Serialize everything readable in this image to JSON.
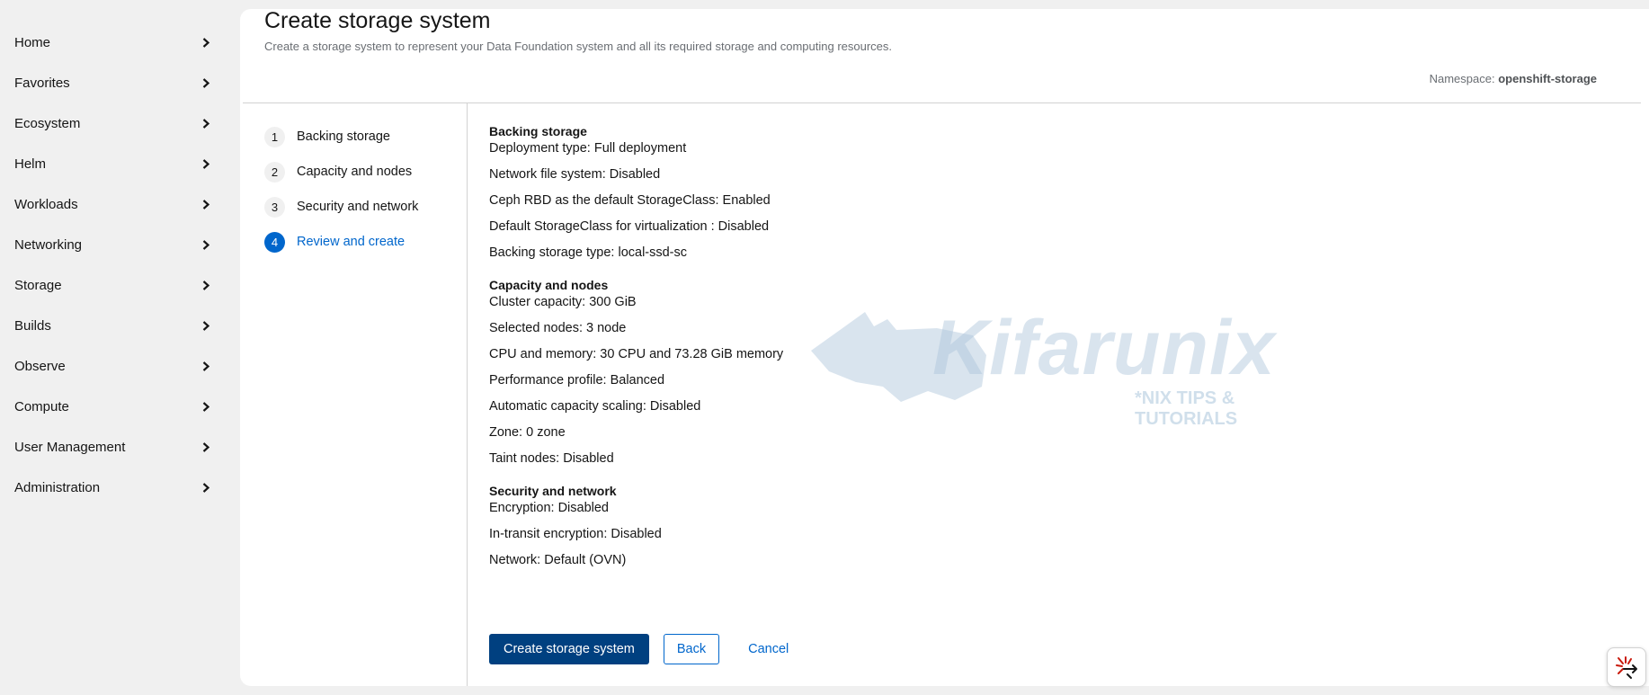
{
  "sidebar": {
    "items": [
      {
        "label": "Home"
      },
      {
        "label": "Favorites"
      },
      {
        "label": "Ecosystem"
      },
      {
        "label": "Helm"
      },
      {
        "label": "Workloads"
      },
      {
        "label": "Networking"
      },
      {
        "label": "Storage"
      },
      {
        "label": "Builds"
      },
      {
        "label": "Observe"
      },
      {
        "label": "Compute"
      },
      {
        "label": "User Management"
      },
      {
        "label": "Administration"
      }
    ]
  },
  "page": {
    "title": "Create storage system",
    "description": "Create a storage system to represent your Data Foundation system and all its required storage and computing resources.",
    "namespace_label": "Namespace:",
    "namespace_value": "openshift-storage"
  },
  "wizard": {
    "steps": [
      {
        "number": "1",
        "label": "Backing storage"
      },
      {
        "number": "2",
        "label": "Capacity and nodes"
      },
      {
        "number": "3",
        "label": "Security and network"
      },
      {
        "number": "4",
        "label": "Review and create"
      }
    ],
    "active_step": "4"
  },
  "review": {
    "backing_storage": {
      "title": "Backing storage",
      "lines": [
        "Deployment type: Full deployment",
        "Network file system: Disabled",
        "Ceph RBD as the default StorageClass: Enabled",
        "Default StorageClass for virtualization : Disabled",
        "Backing storage type: local-ssd-sc"
      ]
    },
    "capacity_nodes": {
      "title": "Capacity and nodes",
      "lines": [
        "Cluster capacity: 300 GiB",
        "Selected nodes: 3 node",
        "CPU and memory: 30 CPU and 73.28 GiB memory",
        "Performance profile: Balanced",
        "Automatic capacity scaling: Disabled",
        "Zone: 0 zone",
        "Taint nodes: Disabled"
      ]
    },
    "security_network": {
      "title": "Security and network",
      "lines": [
        "Encryption: Disabled",
        "In-transit encryption: Disabled",
        "Network: Default (OVN)"
      ]
    }
  },
  "actions": {
    "create_label": "Create storage system",
    "back_label": "Back",
    "cancel_label": "Cancel"
  },
  "watermark": {
    "brand": "Kifarunix",
    "tagline": "*NIX TIPS & TUTORIALS"
  },
  "colors": {
    "accent": "#0066cc",
    "primary_button": "#004080",
    "sidebar_bg": "#f0f0f0"
  },
  "icons": {
    "nav_chevron": "chevron-right-icon",
    "fab": "quick-starts-icon"
  }
}
